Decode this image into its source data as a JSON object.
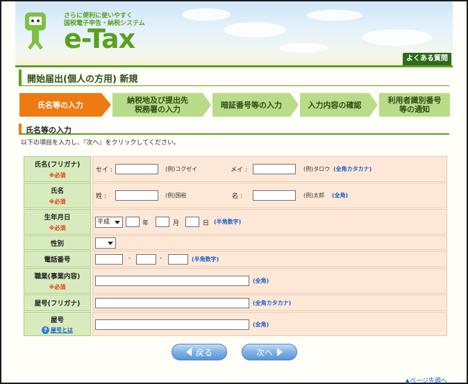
{
  "header": {
    "tagline_line1": "さらに便利に使いやすく",
    "tagline_line2": "国税電子申告・納税システム",
    "logo_text": "e-Tax",
    "faq_label": "よくある質問"
  },
  "page_title": "開始届出(個人の方用)  新規",
  "steps": [
    {
      "line1": "氏名等の入力",
      "line2": ""
    },
    {
      "line1": "納税地及び提出先",
      "line2": "税務署の入力"
    },
    {
      "line1": "暗証番号等の入力",
      "line2": ""
    },
    {
      "line1": "入力内容の確認",
      "line2": ""
    },
    {
      "line1": "利用者識別番号",
      "line2": "等の通知"
    }
  ],
  "section": {
    "title": "氏名等の入力",
    "instruction": "以下の項目を入力し、『次へ』をクリックしてください。"
  },
  "form": {
    "required": "※必須",
    "furigana": {
      "label": "氏名(フリガナ)",
      "sei_label": "セイ :",
      "sei_example": "(例)コクゼイ",
      "mei_label": "メイ :",
      "mei_example": "(例)タロウ",
      "note": "(全角カタカナ)"
    },
    "name": {
      "label": "氏名",
      "sei_label": "姓 :",
      "sei_example": "(例)国税",
      "mei_label": "名 :",
      "mei_example": "(例)太郎",
      "note": "(全角)"
    },
    "birthdate": {
      "label": "生年月日",
      "era_value": "平成",
      "year_unit": "年",
      "month_unit": "月",
      "day_unit": "日",
      "note": "(半角数字)"
    },
    "gender": {
      "label": "性別",
      "value": ""
    },
    "phone": {
      "label": "電話番号",
      "dash": "-",
      "note": "(半角数字)"
    },
    "occupation": {
      "label": "職業(事業内容)",
      "note": "(全角)"
    },
    "shop_kana": {
      "label": "屋号(フリガナ)",
      "note": "(全角カタカナ)"
    },
    "shop": {
      "label": "屋号",
      "help": "屋号とは",
      "help_icon": "?",
      "note": "(全角)"
    }
  },
  "buttons": {
    "back": "戻る",
    "next": "次へ"
  },
  "footer": {
    "page_top": "ページ先頭へ"
  }
}
